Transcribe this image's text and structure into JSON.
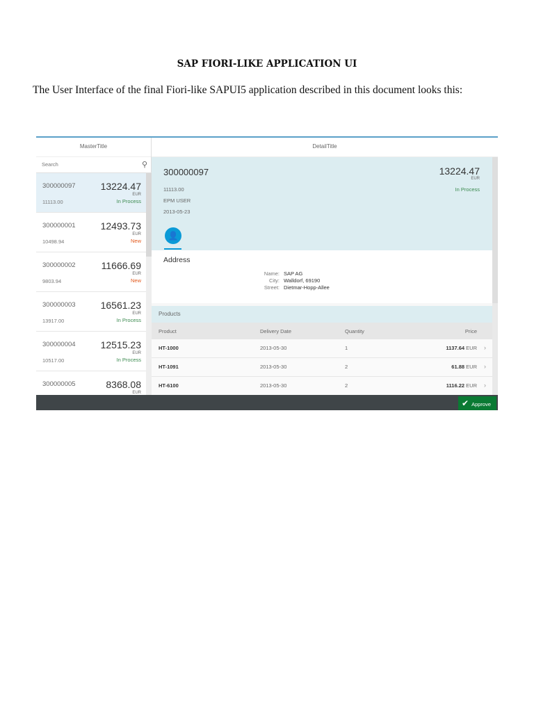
{
  "document": {
    "title": "SAP FIORI-LIKE APPLICATION UI",
    "paragraph": "The User Interface of the final Fiori-like SAPUI5 application described in this document looks this:"
  },
  "master": {
    "title": "MasterTitle",
    "search_placeholder": "Search",
    "items": [
      {
        "id": "300000097",
        "amount": "13224.47",
        "currency": "EUR",
        "sub": "11113.00",
        "status": "In Process"
      },
      {
        "id": "300000001",
        "amount": "12493.73",
        "currency": "EUR",
        "sub": "10498.94",
        "status": "New"
      },
      {
        "id": "300000002",
        "amount": "11666.69",
        "currency": "EUR",
        "sub": "9803.94",
        "status": "New"
      },
      {
        "id": "300000003",
        "amount": "16561.23",
        "currency": "EUR",
        "sub": "13917.00",
        "status": "In Process"
      },
      {
        "id": "300000004",
        "amount": "12515.23",
        "currency": "EUR",
        "sub": "10517.00",
        "status": "In Process"
      },
      {
        "id": "300000005",
        "amount": "8368.08",
        "currency": "EUR",
        "sub": "",
        "status": ""
      }
    ]
  },
  "detail": {
    "title": "DetailTitle",
    "header": {
      "title": "300000097",
      "number": "13224.47",
      "currency": "EUR",
      "status": "In Process",
      "attributes": [
        "11113.00",
        "EPM USER",
        "2013-05-23"
      ]
    },
    "address": {
      "title": "Address",
      "name_label": "Name:",
      "name": "SAP AG",
      "city_label": "City:",
      "city": "Walldorf, 69190",
      "street_label": "Street:",
      "street": "Dietmar-Hopp-Allee"
    },
    "products": {
      "title": "Products",
      "columns": [
        "Product",
        "Delivery Date",
        "Quantity",
        "Price"
      ],
      "rows": [
        {
          "product": "HT-1000",
          "date": "2013-05-30",
          "qty": "1",
          "price": "1137.64",
          "currency": "EUR"
        },
        {
          "product": "HT-1091",
          "date": "2013-05-30",
          "qty": "2",
          "price": "61.88",
          "currency": "EUR"
        },
        {
          "product": "HT-6100",
          "date": "2013-05-30",
          "qty": "2",
          "price": "1116.22",
          "currency": "EUR"
        }
      ]
    }
  },
  "footer": {
    "approve_label": "Approve"
  },
  "colors": {
    "accent": "#0a9ad7",
    "success": "#3b8a4f",
    "new": "#e2581b",
    "approve": "#0a7a33",
    "footer": "#3f4548"
  }
}
